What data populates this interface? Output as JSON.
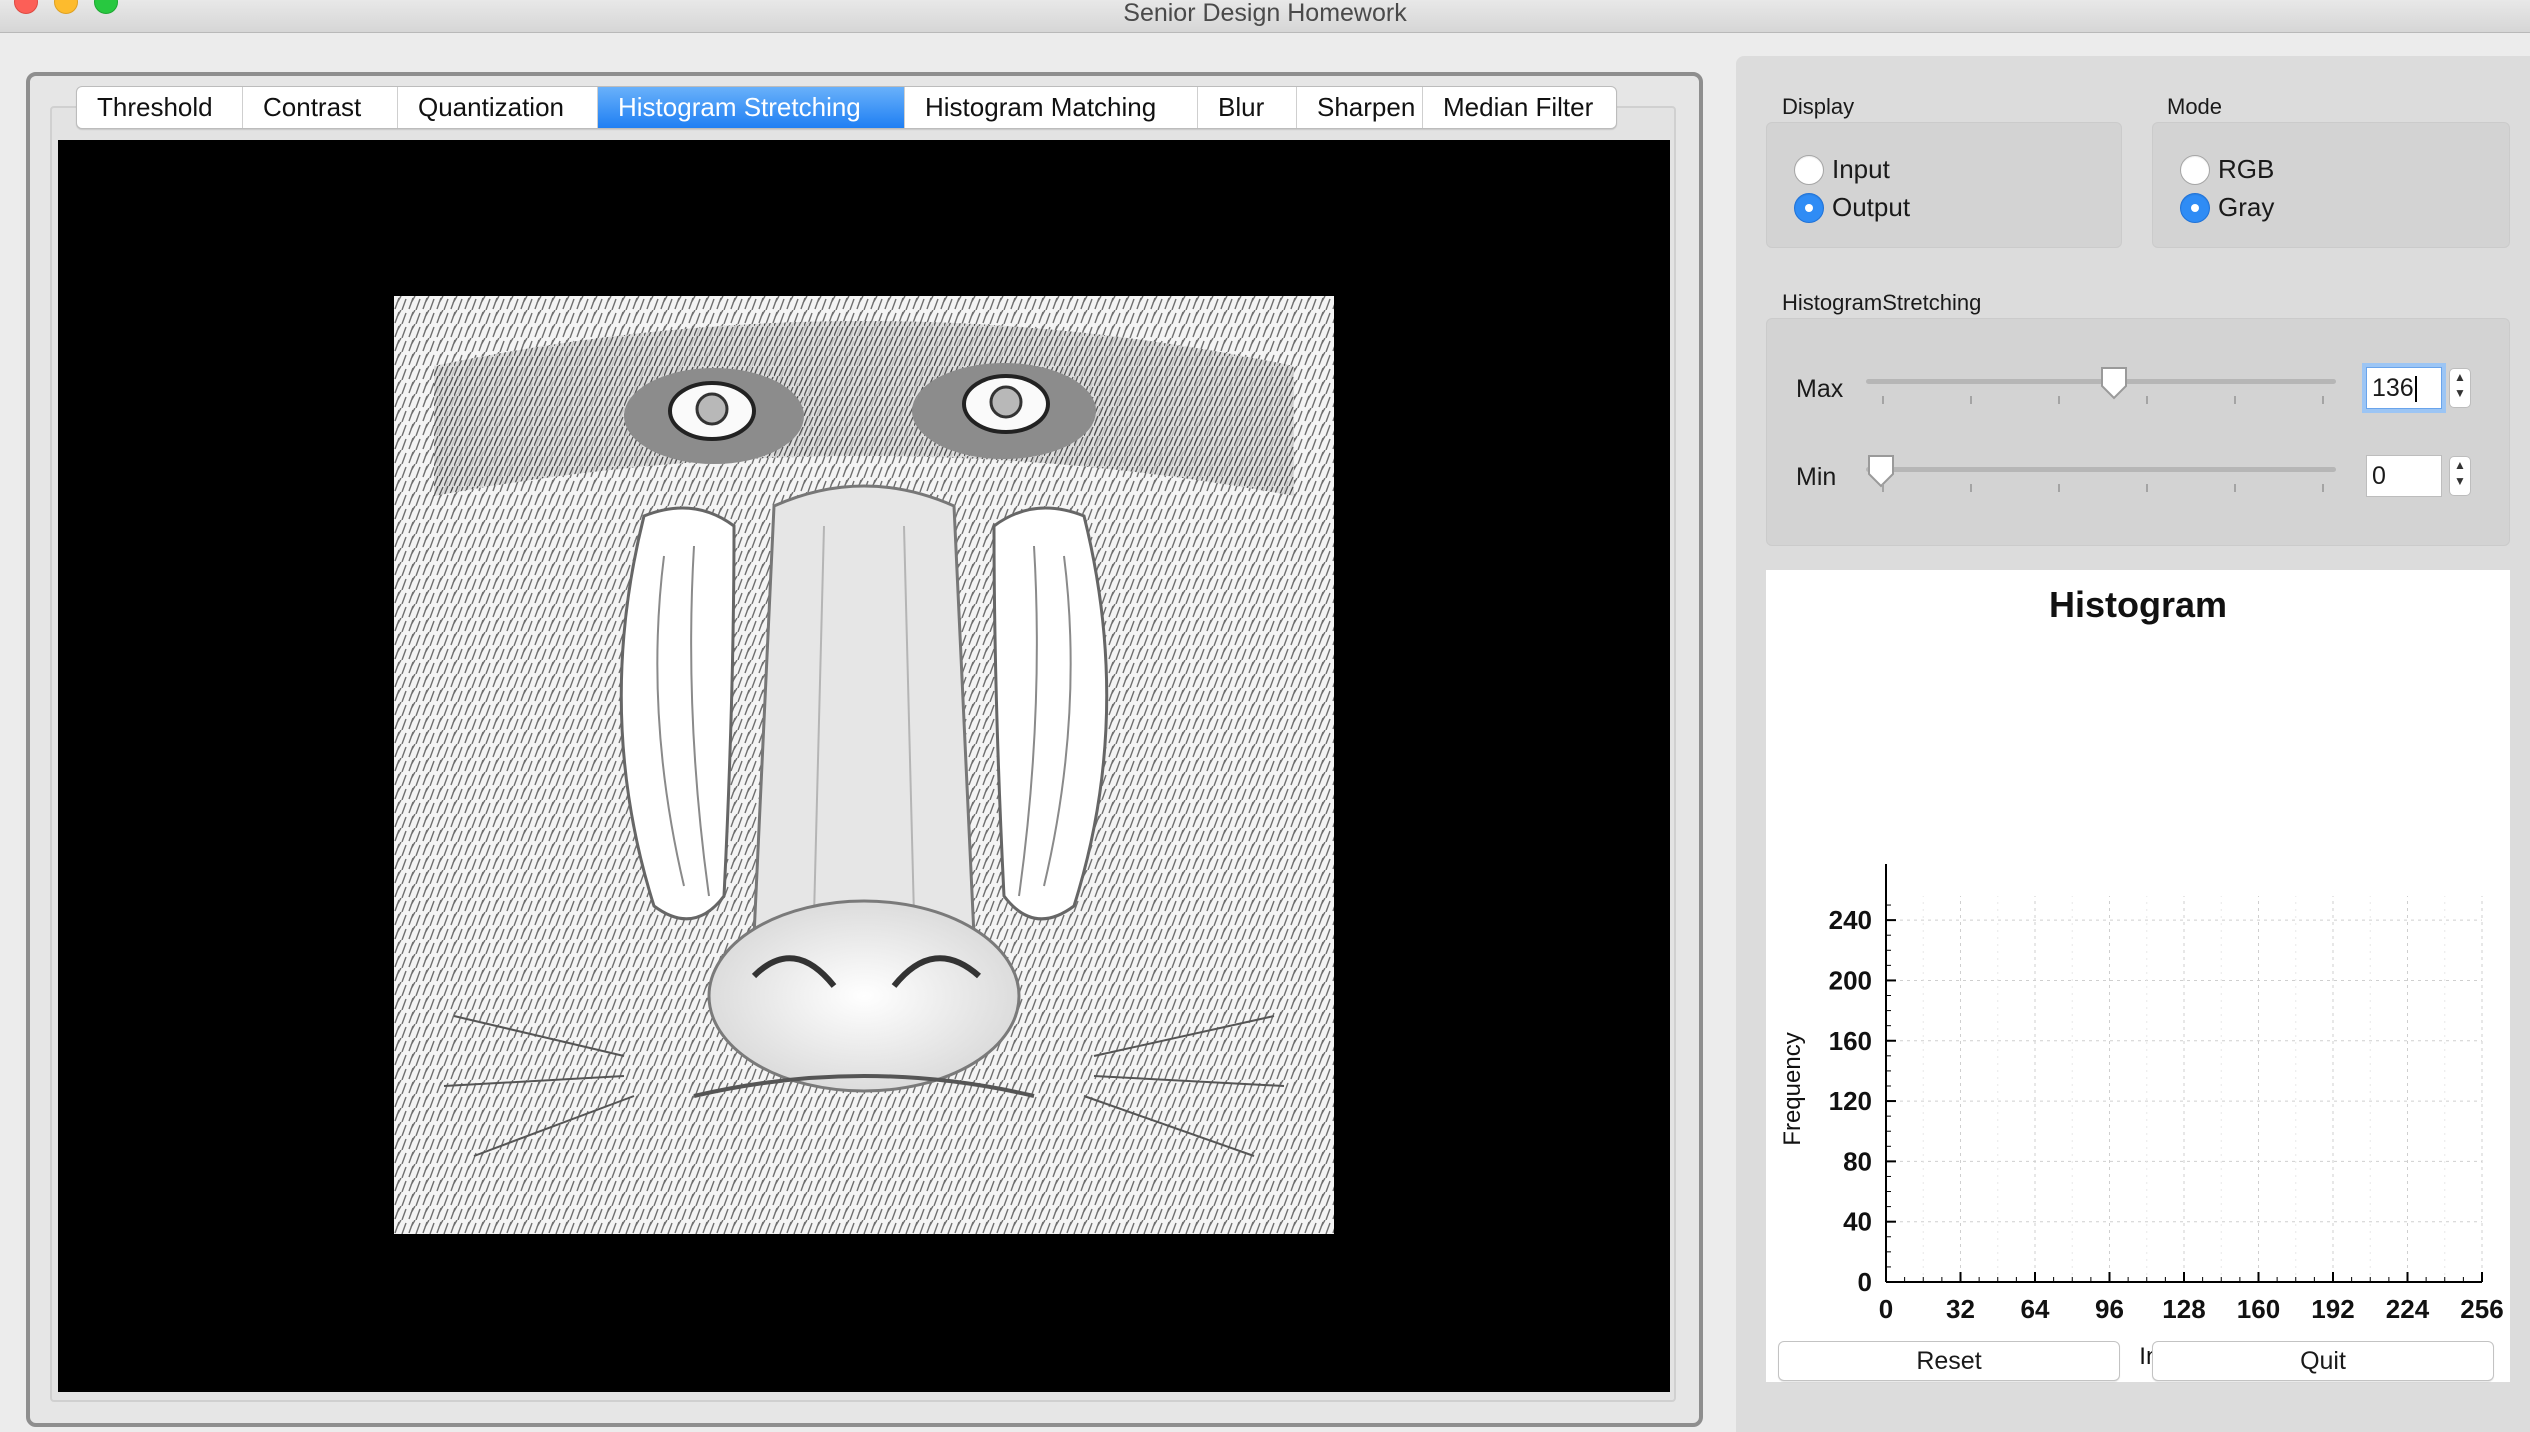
{
  "window": {
    "title": "Senior Design Homework"
  },
  "tabs": [
    {
      "label": "Threshold",
      "active": false
    },
    {
      "label": "Contrast",
      "active": false
    },
    {
      "label": "Quantization",
      "active": false
    },
    {
      "label": "Histogram Stretching",
      "active": true
    },
    {
      "label": "Histogram Matching",
      "active": false
    },
    {
      "label": "Blur",
      "active": false
    },
    {
      "label": "Sharpen",
      "active": false
    },
    {
      "label": "Median Filter",
      "active": false
    }
  ],
  "display": {
    "group_label": "Display",
    "options": [
      {
        "label": "Input",
        "checked": false
      },
      {
        "label": "Output",
        "checked": true
      }
    ]
  },
  "mode": {
    "group_label": "Mode",
    "options": [
      {
        "label": "RGB",
        "checked": false
      },
      {
        "label": "Gray",
        "checked": true
      }
    ]
  },
  "histogram_stretching": {
    "group_label": "HistogramStretching",
    "max": {
      "label": "Max",
      "value": "136",
      "slider_fraction": 0.53
    },
    "min": {
      "label": "Min",
      "value": "0",
      "slider_fraction": 0.0
    }
  },
  "buttons": {
    "reset": "Reset",
    "quit": "Quit"
  },
  "chart_data": {
    "type": "bar",
    "title": "Histogram",
    "xlabel": "Intensity",
    "ylabel": "Frequency",
    "xlim": [
      0,
      256
    ],
    "ylim": [
      0,
      256
    ],
    "x_ticks": [
      "0",
      "32",
      "64",
      "96",
      "128",
      "160",
      "192",
      "224",
      "256"
    ],
    "y_ticks": [
      "0",
      "40",
      "80",
      "120",
      "160",
      "200",
      "240"
    ],
    "grid": true,
    "series": [],
    "colors": {
      "axis": "#000000",
      "grid": "#cfcfcf"
    }
  },
  "colors": {
    "accent": "#2f8cf5",
    "image_background": "#000000"
  }
}
